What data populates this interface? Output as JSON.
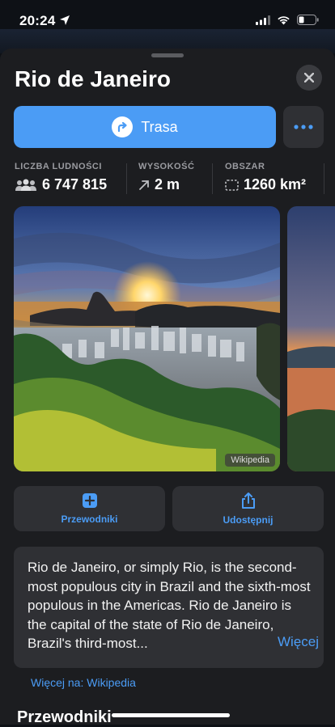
{
  "status": {
    "time": "20:24"
  },
  "place": {
    "title": "Rio de Janeiro"
  },
  "actions": {
    "route_label": "Trasa"
  },
  "stats": [
    {
      "label": "LICZBA LUDNOŚCI",
      "value": "6 747 815",
      "icon": "people-icon"
    },
    {
      "label": "WYSOKOŚĆ",
      "value": "2 m",
      "icon": "elevation-arrow-icon"
    },
    {
      "label": "OBSZAR",
      "value": "1260 km²",
      "icon": "area-icon"
    }
  ],
  "photo": {
    "credit": "Wikipedia"
  },
  "buttons": {
    "guides": "Przewodniki",
    "share": "Udostępnij"
  },
  "description": {
    "text": "Rio de Janeiro, or simply Rio, is the second-most populous city in Brazil and the sixth-most populous in the Americas. Rio de Janeiro is the capital of the state of Rio de Janeiro, Brazil's third-most...",
    "more": "Więcej"
  },
  "wiki_link": "Więcej na: Wikipedia",
  "section": {
    "guides_title": "Przewodniki"
  },
  "colors": {
    "accent": "#4b9cf5",
    "sheet": "#1c1d20",
    "card": "#2f3034"
  }
}
